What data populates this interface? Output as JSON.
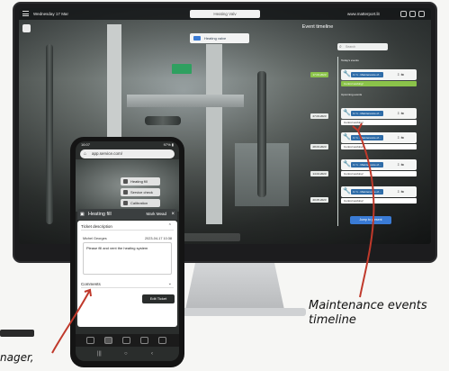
{
  "app": {
    "date": "Wednesday 17 Mar",
    "search_text": "Heating Valv",
    "url": "www.matterport.lit",
    "tag_label": "Heating valve"
  },
  "timeline": {
    "title": "Event timeline",
    "search_placeholder": "Search",
    "groups": [
      "Today's events",
      "Upcoming events"
    ],
    "events": [
      {
        "date": "17.03.2023",
        "today": true,
        "name": "3 / 1 - Maintenance of...",
        "status": "Control working!"
      },
      {
        "date": "27.03.2023",
        "today": false,
        "name": "3 / 1 - Maintenance of...",
        "status": "Control working!"
      },
      {
        "date": "28.03.2023",
        "today": false,
        "name": "3 / 1 - Maintenance of...",
        "status": "Control working!"
      },
      {
        "date": "14.04.2023",
        "today": false,
        "name": "3 / 1 - Maintenance of...",
        "status": "Control working!"
      },
      {
        "date": "20.05.2023",
        "today": false,
        "name": "3 / 1 - Maintenance of...",
        "status": "Control working!"
      }
    ],
    "jump_label": "Jump to present"
  },
  "phone": {
    "time": "16:07",
    "signal": "97% ▮",
    "address": "app.service.com/",
    "tags": [
      "Heating fill",
      "Service check",
      "Calibration"
    ],
    "ticket": {
      "title": "Heating fill",
      "mark": "Mark Mead",
      "section_description": "Ticket description",
      "author": "Michel Georges",
      "time": "2023-04-17 10:38",
      "body": "Please fill and vent the heating system",
      "section_comments": "Comments",
      "edit_label": "Edit Ticket"
    }
  },
  "annotations": {
    "main": "Maintenance events timeline",
    "left": "nager,"
  },
  "colors": {
    "accent": "#3a7bd5",
    "today": "#8bc34a",
    "annotation_arrow": "#c0392b"
  }
}
